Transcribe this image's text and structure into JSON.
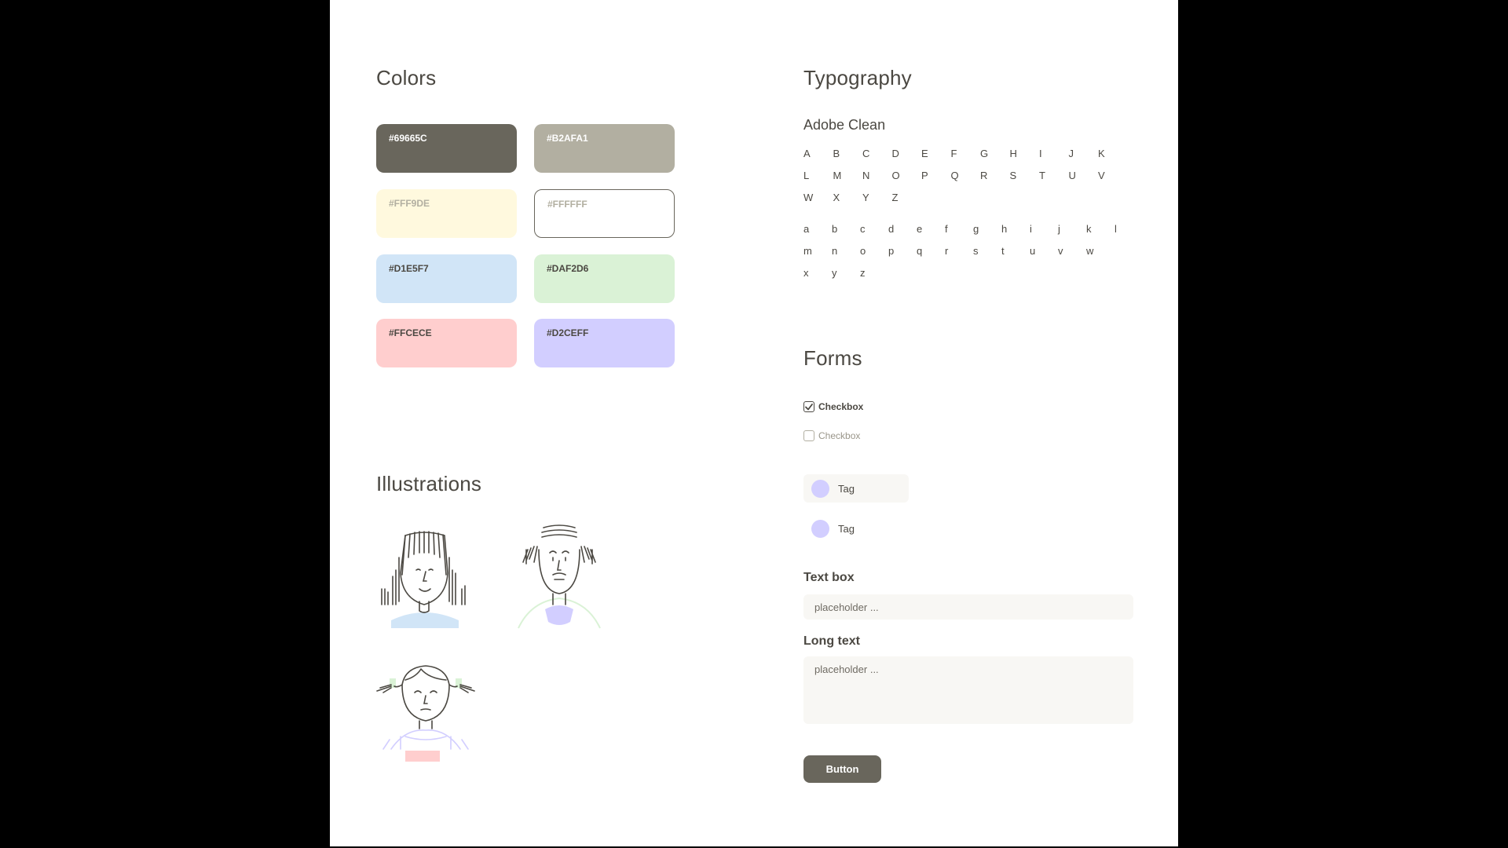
{
  "sections": {
    "colors": "Colors",
    "typography": "Typography",
    "illustrations": "Illustrations",
    "forms": "Forms"
  },
  "colors": [
    {
      "hex": "#69665C",
      "label": "#69665C",
      "text_color": "#ffffff",
      "border": ""
    },
    {
      "hex": "#B2AFA1",
      "label": "#B2AFA1",
      "text_color": "#ffffff",
      "border": ""
    },
    {
      "hex": "#FFF9DE",
      "label": "#FFF9DE",
      "text_color": "#b2afa1",
      "border": ""
    },
    {
      "hex": "#FFFFFF",
      "label": "#FFFFFF",
      "text_color": "#b2afa1",
      "border": "#69665C"
    },
    {
      "hex": "#D1E5F7",
      "label": "#D1E5F7",
      "text_color": "#4b4842",
      "border": ""
    },
    {
      "hex": "#DAF2D6",
      "label": "#DAF2D6",
      "text_color": "#4b4842",
      "border": ""
    },
    {
      "hex": "#FFCECE",
      "label": "#FFCECE",
      "text_color": "#4b4842",
      "border": ""
    },
    {
      "hex": "#D2CEFF",
      "label": "#D2CEFF",
      "text_color": "#4b4842",
      "border": ""
    }
  ],
  "typography": {
    "font_name": "Adobe Clean",
    "uppercase": [
      [
        "A",
        "B",
        "C",
        "D",
        "E",
        "F",
        "G",
        "H",
        "I",
        "J",
        "K"
      ],
      [
        "L",
        "M",
        "N",
        "O",
        "P",
        "Q",
        "R",
        "S",
        "T",
        "U",
        "V"
      ],
      [
        "W",
        "X",
        "Y",
        "Z"
      ]
    ],
    "lowercase": [
      [
        "a",
        "b",
        "c",
        "d",
        "e",
        "f",
        "g",
        "h",
        "i",
        "j",
        "k",
        "l"
      ],
      [
        "m",
        "n",
        "o",
        "p",
        "q",
        "r",
        "s",
        "t",
        "u",
        "v",
        "w"
      ],
      [
        "x",
        "y",
        "z"
      ]
    ]
  },
  "illustrations": [
    {
      "name": "girl-with-bangs-illustration"
    },
    {
      "name": "bald-man-illustration"
    },
    {
      "name": "child-with-pigtails-illustration"
    }
  ],
  "forms": {
    "checkboxes": [
      {
        "label": "Checkbox",
        "checked": true
      },
      {
        "label": "Checkbox",
        "checked": false
      }
    ],
    "tags": [
      {
        "label": "Tag",
        "selected": true
      },
      {
        "label": "Tag",
        "selected": false
      }
    ],
    "text_box": {
      "label": "Text box",
      "placeholder": "placeholder ..."
    },
    "long_text": {
      "label": "Long text",
      "placeholder": "placeholder ..."
    },
    "button": {
      "label": "Button",
      "color": "#69665C"
    }
  },
  "accent": "#69665C"
}
